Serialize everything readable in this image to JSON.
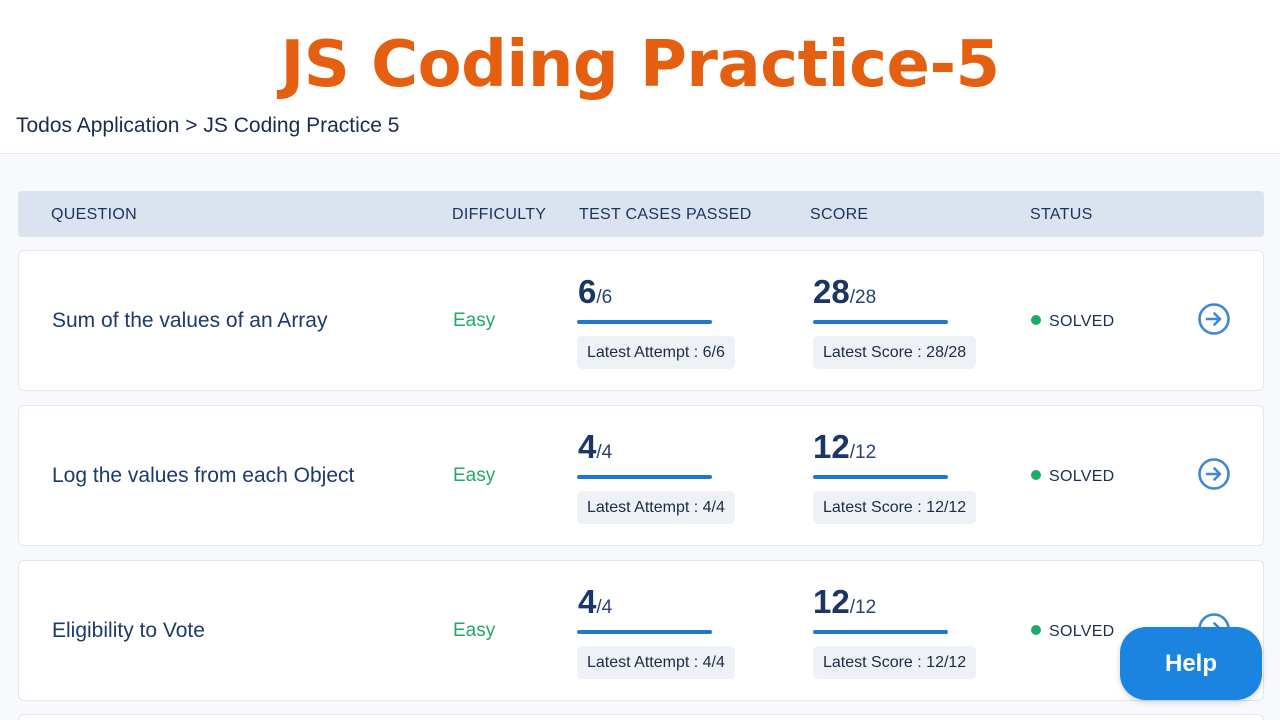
{
  "page": {
    "title": "JS Coding Practice-5",
    "breadcrumb": "Todos Application > JS Coding Practice 5"
  },
  "table": {
    "columns": [
      "QUESTION",
      "DIFFICULTY",
      "TEST CASES PASSED",
      "SCORE",
      "STATUS"
    ],
    "rows": [
      {
        "question": "Sum of the values of an Array",
        "difficulty": "Easy",
        "tests_passed": "6",
        "tests_total": "/6",
        "latest_attempt": "Latest Attempt : 6/6",
        "score": "28",
        "score_total": "/28",
        "latest_score": "Latest Score : 28/28",
        "status": "SOLVED"
      },
      {
        "question": "Log the values from each Object",
        "difficulty": "Easy",
        "tests_passed": "4",
        "tests_total": "/4",
        "latest_attempt": "Latest Attempt : 4/4",
        "score": "12",
        "score_total": "/12",
        "latest_score": "Latest Score : 12/12",
        "status": "SOLVED"
      },
      {
        "question": "Eligibility to Vote",
        "difficulty": "Easy",
        "tests_passed": "4",
        "tests_total": "/4",
        "latest_attempt": "Latest Attempt : 4/4",
        "score": "12",
        "score_total": "/12",
        "latest_score": "Latest Score : 12/12",
        "status": "SOLVED"
      }
    ]
  },
  "help_button": {
    "label": "Help"
  },
  "icons": {
    "row_action": "arrow-right-circle-icon",
    "status": "status-dot-icon"
  },
  "colors": {
    "title": "#e45f10",
    "accent": "#1e78cf",
    "easy": "#23a86b",
    "solved_dot": "#1faa6b",
    "help_button": "#1a84e0"
  }
}
